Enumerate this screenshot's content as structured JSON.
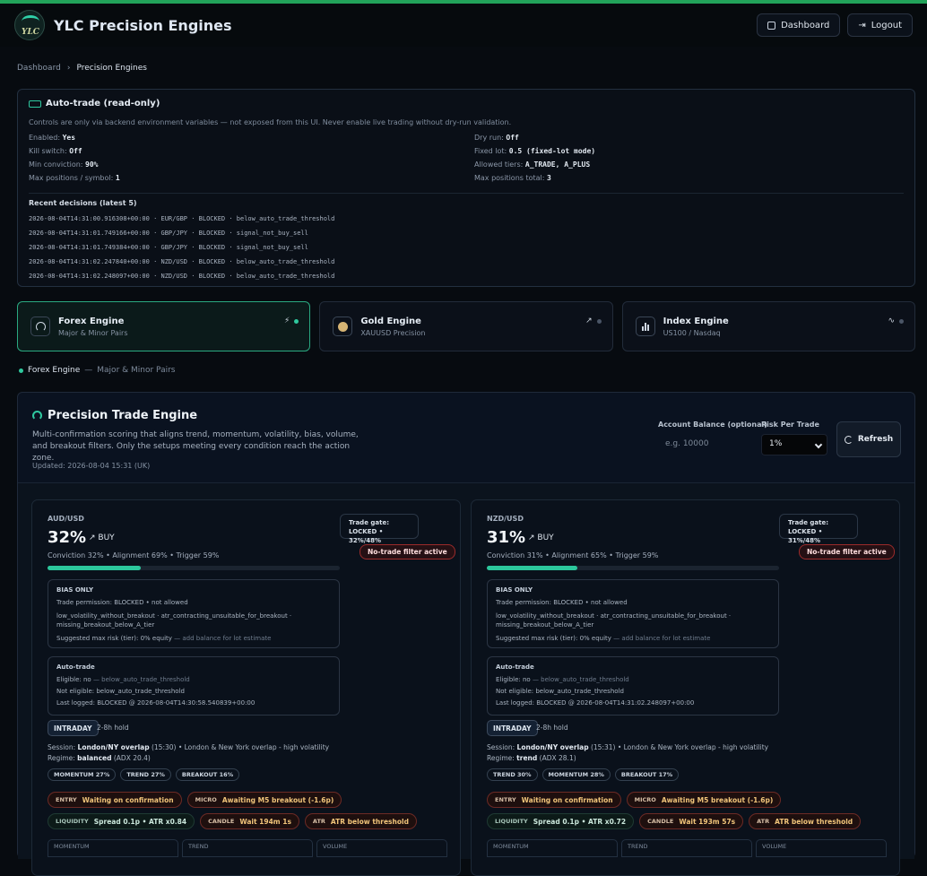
{
  "app": {
    "title": "YLC Precision Engines",
    "logo_text": "YLC"
  },
  "header": {
    "dashboard": "Dashboard",
    "logout": "Logout"
  },
  "breadcrumb": {
    "root": "Dashboard",
    "sep": "›",
    "current": "Precision Engines"
  },
  "autotrade": {
    "title": "Auto-trade (read-only)",
    "note": "Controls are only via backend environment variables — not exposed from this UI. Never enable live trading without dry-run validation.",
    "left": [
      {
        "k": "Enabled:",
        "v": "Yes"
      },
      {
        "k": "Kill switch:",
        "v": "Off"
      },
      {
        "k": "Min conviction:",
        "v": "90%"
      },
      {
        "k": "Max positions / symbol:",
        "v": "1"
      }
    ],
    "right": [
      {
        "k": "Dry run:",
        "v": "Off"
      },
      {
        "k": "Fixed lot:",
        "v": "0.5 (fixed-lot mode)"
      },
      {
        "k": "Allowed tiers:",
        "v": "A_TRADE, A_PLUS"
      },
      {
        "k": "Max positions total:",
        "v": "3"
      }
    ],
    "recent_title": "Recent decisions (latest 5)",
    "recent": [
      "2026-08-04T14:31:00.916308+00:00 · EUR/GBP · BLOCKED · below_auto_trade_threshold",
      "2026-08-04T14:31:01.749166+00:00 · GBP/JPY · BLOCKED · signal_not_buy_sell",
      "2026-08-04T14:31:01.749384+00:00 · GBP/JPY · BLOCKED · signal_not_buy_sell",
      "2026-08-04T14:31:02.247840+00:00 · NZD/USD · BLOCKED · below_auto_trade_threshold",
      "2026-08-04T14:31:02.248097+00:00 · NZD/USD · BLOCKED · below_auto_trade_threshold"
    ]
  },
  "engines": [
    {
      "name": "Forex Engine",
      "sub": "Major & Minor Pairs",
      "status_icon": "⚡"
    },
    {
      "name": "Gold Engine",
      "sub": "XAUUSD Precision",
      "status_icon": "↗"
    },
    {
      "name": "Index Engine",
      "sub": "US100 / Nasdaq",
      "status_icon": "∿"
    }
  ],
  "selected": {
    "name": "Forex Engine",
    "sep": "—",
    "sub": "Major & Minor Pairs"
  },
  "engine_panel": {
    "title": "Precision Trade Engine",
    "desc": "Multi-confirmation scoring that aligns trend, momentum, volatility, bias, volume, and breakout filters. Only the setups meeting every condition reach the action zone.",
    "updated": "Updated: 2026-08-04 15:31 (UK)",
    "balance_label": "Account Balance (optional)",
    "balance_placeholder": "e.g. 10000",
    "risk_label": "Risk Per Trade",
    "risk_value": "1%",
    "refresh": "Refresh"
  },
  "cards": [
    {
      "pair": "AUD/USD",
      "pct": "32%",
      "dir": "↗ BUY",
      "conv": "Conviction 32% • Alignment 69% • Trigger 59%",
      "progress": 0.32,
      "gate": "Trade gate: LOCKED • 32%/48%",
      "ntf": "No-trade filter active",
      "b1_title": "BIAS ONLY",
      "b1_l1": "Trade permission: BLOCKED • not allowed",
      "b1_l2": "low_volatility_without_breakout · atr_contracting_unsuitable_for_breakout · missing_breakout_below_A_tier",
      "b1_l3": "Suggested max risk (tier): 0% equity",
      "b1_l3_dim": "— add balance for lot estimate",
      "b2_title": "Auto-trade",
      "b2_l1": "Eligible: no",
      "b2_l1_dim": "— below_auto_trade_threshold",
      "b2_l2": "Not eligible: below_auto_trade_threshold",
      "b2_l3": "Last logged: BLOCKED @ 2026-08-04T14:30:58.540839+00:00",
      "tag": "INTRADAY",
      "hold": "2-8h hold",
      "sess_k": "Session:",
      "sess_b": "London/NY overlap",
      "sess_r": "(15:30) • London & New York overlap - high volatility",
      "reg_k": "Regime:",
      "reg_b": "balanced",
      "reg_r": "(ADX 20.4)",
      "pills": [
        "MOMENTUM 27%",
        "TREND 27%",
        "BREAKOUT 16%"
      ],
      "chips": [
        {
          "k": "ENTRY",
          "v": "Waiting on confirmation"
        },
        {
          "k": "MICRO",
          "v": "Awaiting M5 breakout (-1.6p)"
        },
        {
          "k": "LIQUIDITY",
          "v": "Spread 0.1p • ATR x0.84"
        },
        {
          "k": "CANDLE",
          "v": "Wait 194m 1s"
        },
        {
          "k": "ATR",
          "v": "ATR below threshold"
        }
      ],
      "bottom": [
        "MOMENTUM",
        "TREND",
        "VOLUME"
      ]
    },
    {
      "pair": "NZD/USD",
      "pct": "31%",
      "dir": "↗ BUY",
      "conv": "Conviction 31% • Alignment 65% • Trigger 59%",
      "progress": 0.31,
      "gate": "Trade gate: LOCKED • 31%/48%",
      "ntf": "No-trade filter active",
      "b1_title": "BIAS ONLY",
      "b1_l1": "Trade permission: BLOCKED • not allowed",
      "b1_l2": "low_volatility_without_breakout · atr_contracting_unsuitable_for_breakout · missing_breakout_below_A_tier",
      "b1_l3": "Suggested max risk (tier): 0% equity",
      "b1_l3_dim": "— add balance for lot estimate",
      "b2_title": "Auto-trade",
      "b2_l1": "Eligible: no",
      "b2_l1_dim": "— below_auto_trade_threshold",
      "b2_l2": "Not eligible: below_auto_trade_threshold",
      "b2_l3": "Last logged: BLOCKED @ 2026-08-04T14:31:02.248097+00:00",
      "tag": "INTRADAY",
      "hold": "2-8h hold",
      "sess_k": "Session:",
      "sess_b": "London/NY overlap",
      "sess_r": "(15:31) • London & New York overlap - high volatility",
      "reg_k": "Regime:",
      "reg_b": "trend",
      "reg_r": "(ADX 28.1)",
      "pills": [
        "TREND 30%",
        "MOMENTUM 28%",
        "BREAKOUT 17%"
      ],
      "chips": [
        {
          "k": "ENTRY",
          "v": "Waiting on confirmation"
        },
        {
          "k": "MICRO",
          "v": "Awaiting M5 breakout (-1.6p)"
        },
        {
          "k": "LIQUIDITY",
          "v": "Spread 0.1p • ATR x0.72"
        },
        {
          "k": "CANDLE",
          "v": "Wait 193m 57s"
        },
        {
          "k": "ATR",
          "v": "ATR below threshold"
        }
      ],
      "bottom": [
        "MOMENTUM",
        "TREND",
        "VOLUME"
      ]
    }
  ]
}
